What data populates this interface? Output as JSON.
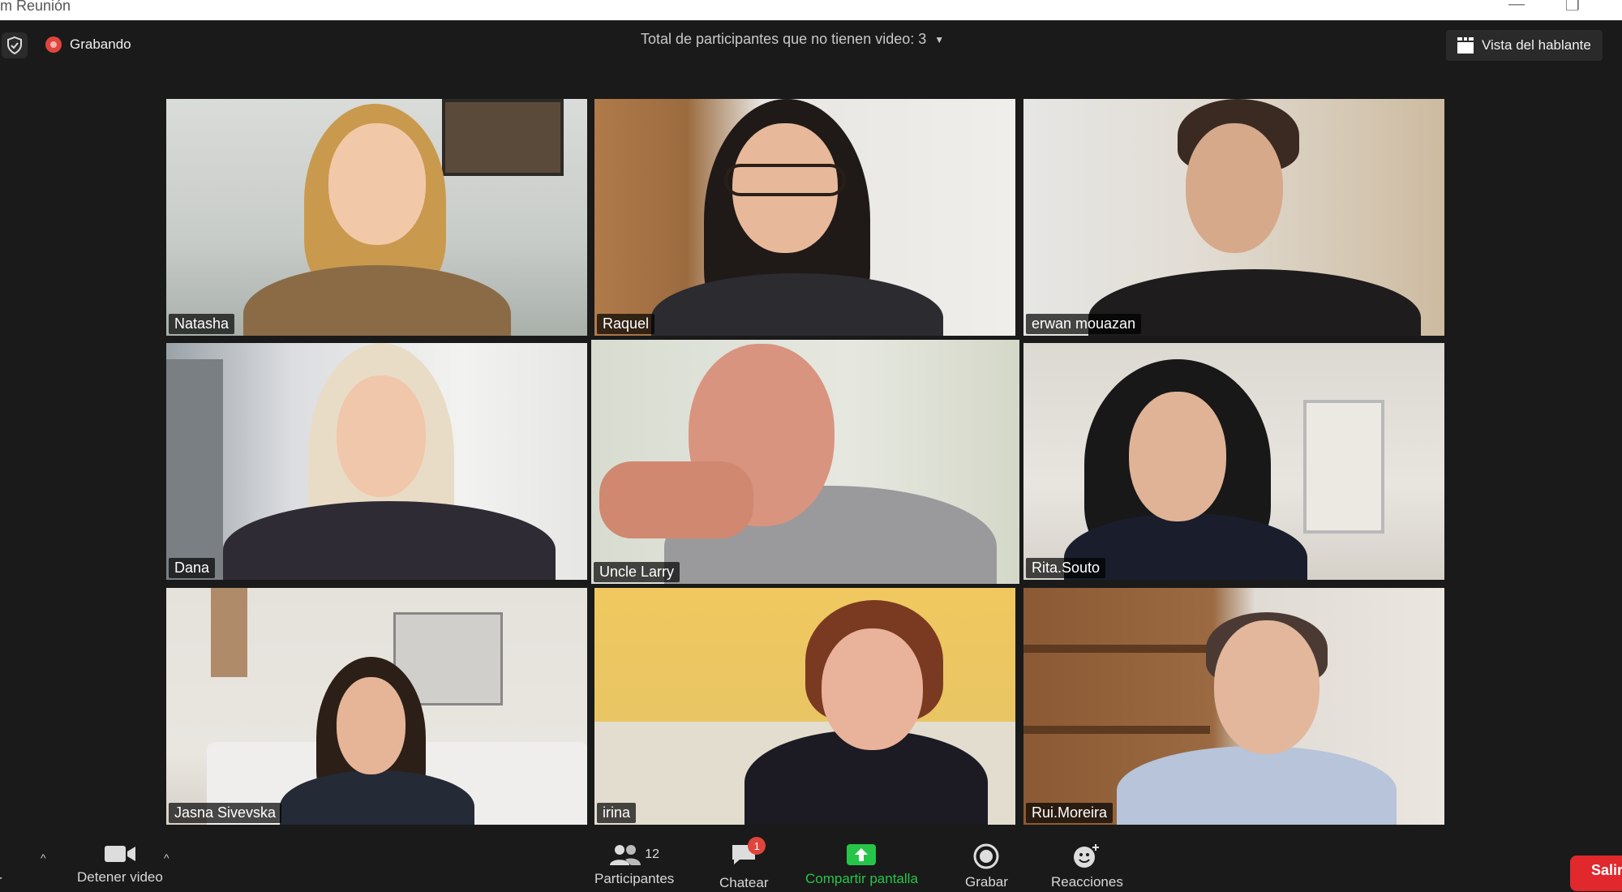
{
  "window": {
    "title": "om Reunión"
  },
  "topbar": {
    "recording_label": "Grabando",
    "no_video_text": "Total de participantes que no tienen video: 3",
    "view_button": "Vista del hablante"
  },
  "participants": [
    {
      "name": "Natasha"
    },
    {
      "name": "Raquel"
    },
    {
      "name": "erwan mouazan"
    },
    {
      "name": "Dana"
    },
    {
      "name": "Uncle Larry",
      "active_speaker": true
    },
    {
      "name": "Rita.Souto"
    },
    {
      "name": "Jasna Sivevska"
    },
    {
      "name": "irina"
    },
    {
      "name": "Rui.Moreira"
    }
  ],
  "controls": {
    "mute_label": "ciar",
    "video_label": "Detener video",
    "participants_label": "Participantes",
    "participants_count": "12",
    "chat_label": "Chatear",
    "chat_badge": "1",
    "share_label": "Compartir pantalla",
    "record_label": "Grabar",
    "reactions_label": "Reacciones",
    "leave_label": "Salir"
  },
  "colors": {
    "background": "#1a1a1a",
    "active_speaker_border": "#b8e05a",
    "share_green": "#27c44a",
    "leave_red": "#e0282d",
    "record_red": "#e0453d"
  }
}
